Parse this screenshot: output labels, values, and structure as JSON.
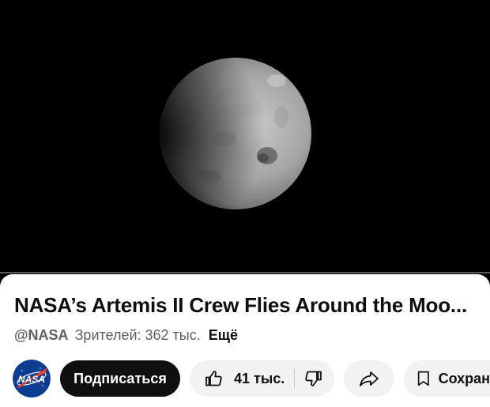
{
  "video": {
    "progress_fraction": 0.0,
    "progress_color": "#ff0033"
  },
  "details": {
    "title": "NASA’s Artemis II Crew Flies Around the Moo...",
    "channel_handle": "@NASA",
    "views": "Зрителей: 362 тыс.",
    "more_label": "Ещё"
  },
  "channel": {
    "avatar_icon": "nasa-logo",
    "avatar_text": "NASA",
    "brand_color": "#0b3d91",
    "accent_color": "#fc3d21"
  },
  "actions": {
    "subscribe_label": "Подписаться",
    "like_count": "41 тыс.",
    "like_icon": "thumb-up-icon",
    "dislike_icon": "thumb-down-icon",
    "share_icon": "share-icon",
    "save_label": "Сохранить",
    "save_icon": "bookmark-icon"
  }
}
